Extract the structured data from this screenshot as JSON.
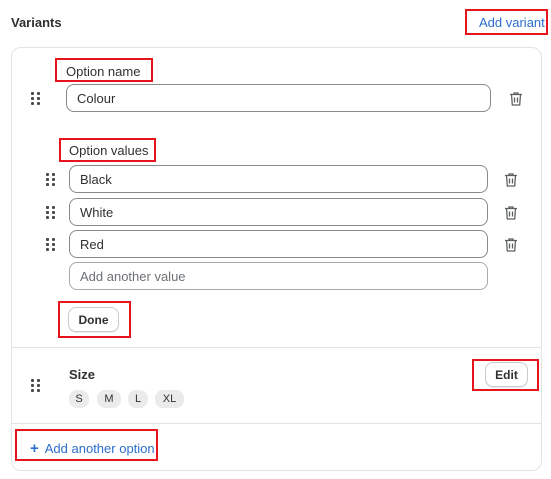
{
  "header": {
    "title": "Variants",
    "add_variant": "Add variant"
  },
  "option_editor": {
    "name_label": "Option name",
    "name_value": "Colour",
    "values_label": "Option values",
    "values": [
      "Black",
      "White",
      "Red"
    ],
    "new_value_placeholder": "Add another value",
    "done_label": "Done"
  },
  "size_option": {
    "name": "Size",
    "values": [
      "S",
      "M",
      "L",
      "XL"
    ],
    "edit_label": "Edit"
  },
  "footer": {
    "add_option_label": "Add another option"
  },
  "colors": {
    "link": "#2c6ecb",
    "highlight": "#e8141c"
  }
}
